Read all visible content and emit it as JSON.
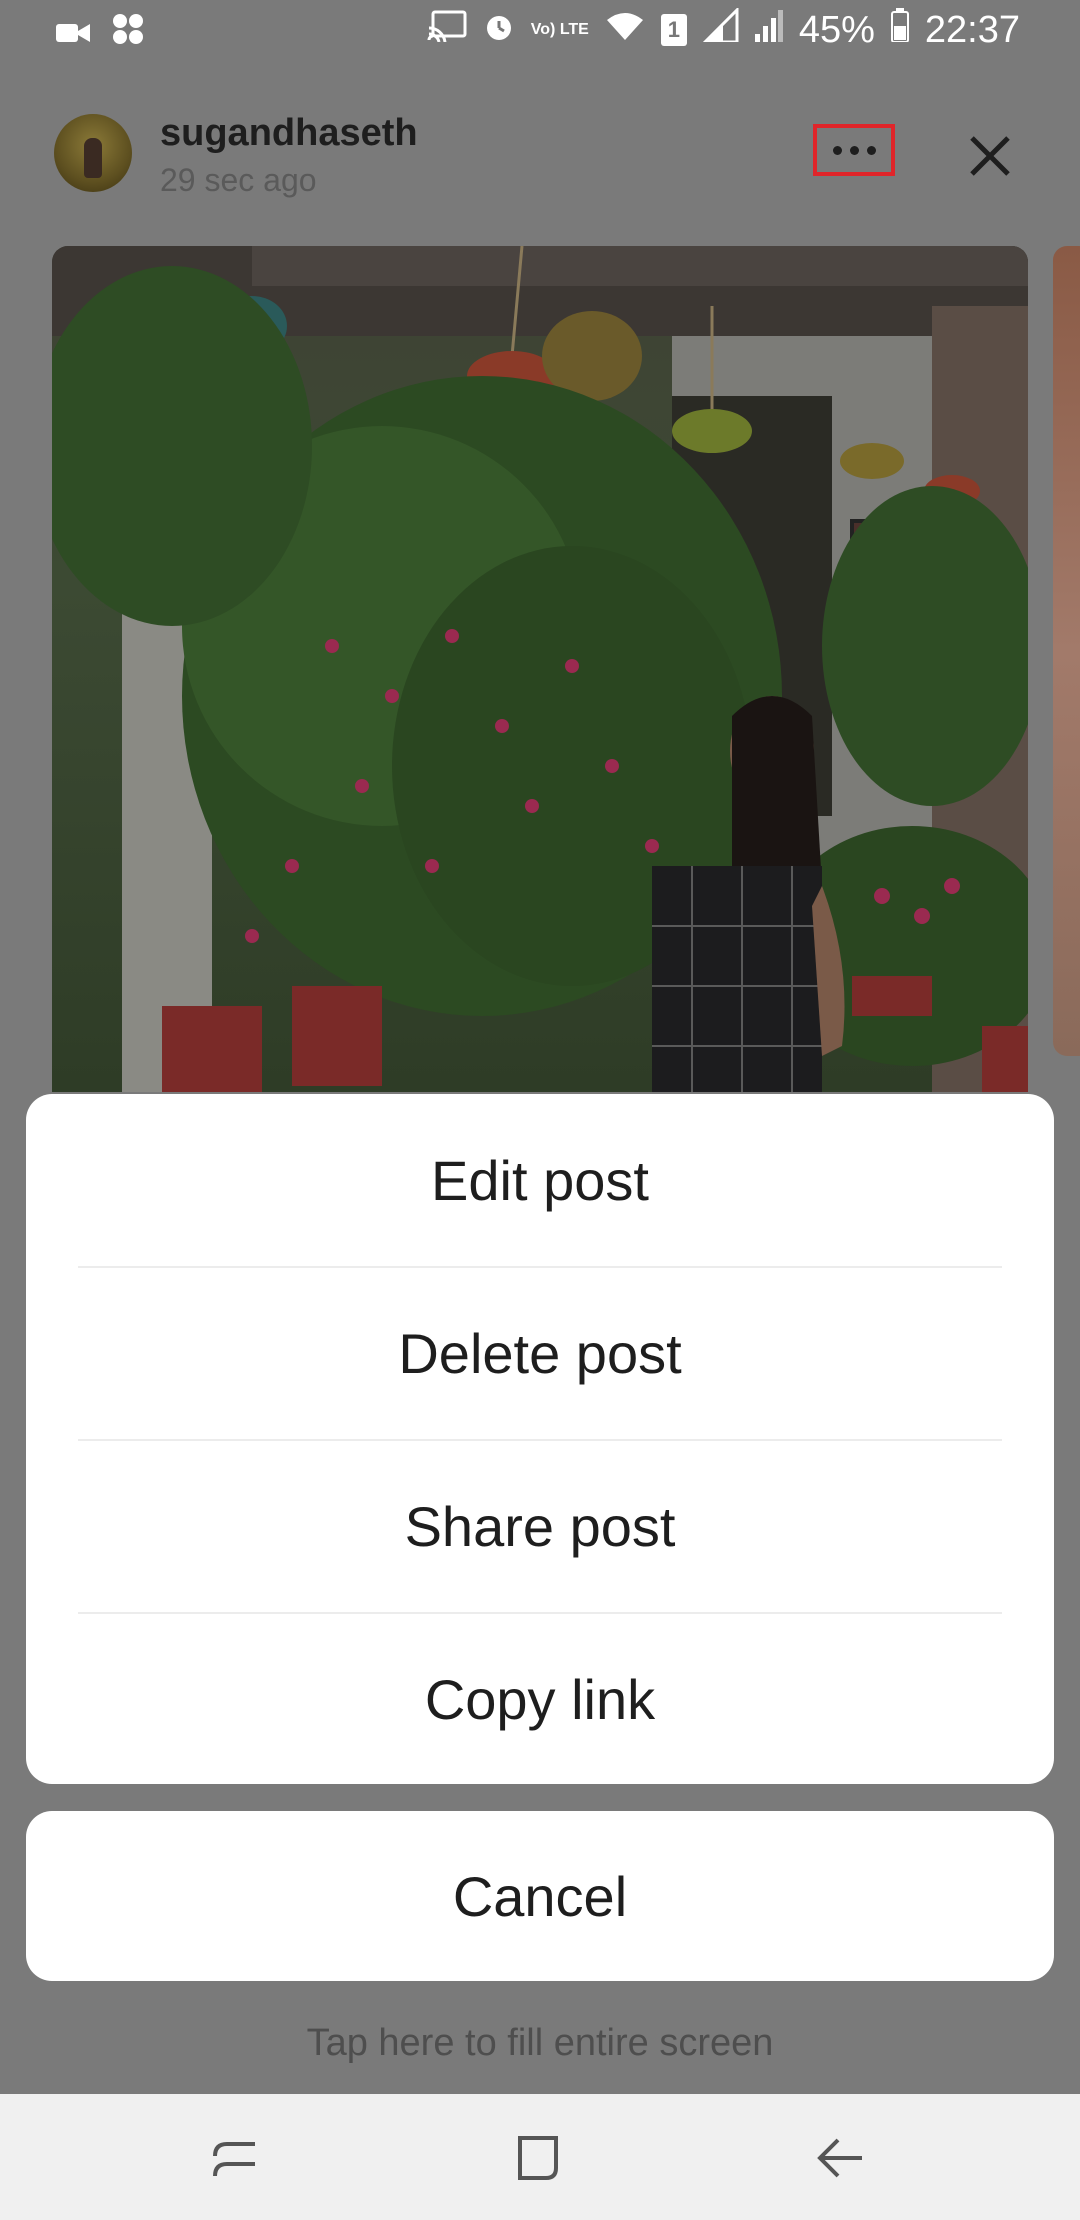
{
  "status_bar": {
    "battery_percent": "45%",
    "time": "22:37",
    "icons": [
      "video-call-icon",
      "app-icon",
      "cast-icon",
      "alarm-icon",
      "volte-icon",
      "wifi-icon",
      "sim1-icon",
      "signal-icon",
      "signal-icon",
      "battery-icon"
    ],
    "volte_label": "Vo) LTE",
    "sim_label": "1"
  },
  "post_header": {
    "username": "sugandhaseth",
    "time_ago": "29 sec ago",
    "more_icon": "more-horizontal-icon",
    "close_icon": "close-icon",
    "highlight_color": "#e0252a"
  },
  "photo": {
    "subject": "post-photo"
  },
  "action_sheet": {
    "items": [
      {
        "label": "Edit post"
      },
      {
        "label": "Delete post"
      },
      {
        "label": "Share post"
      },
      {
        "label": "Copy link"
      }
    ],
    "cancel_label": "Cancel"
  },
  "fill_hint": "Tap here to fill entire screen",
  "nav_bar": {
    "buttons": [
      "recents-icon",
      "home-icon",
      "back-icon"
    ]
  }
}
